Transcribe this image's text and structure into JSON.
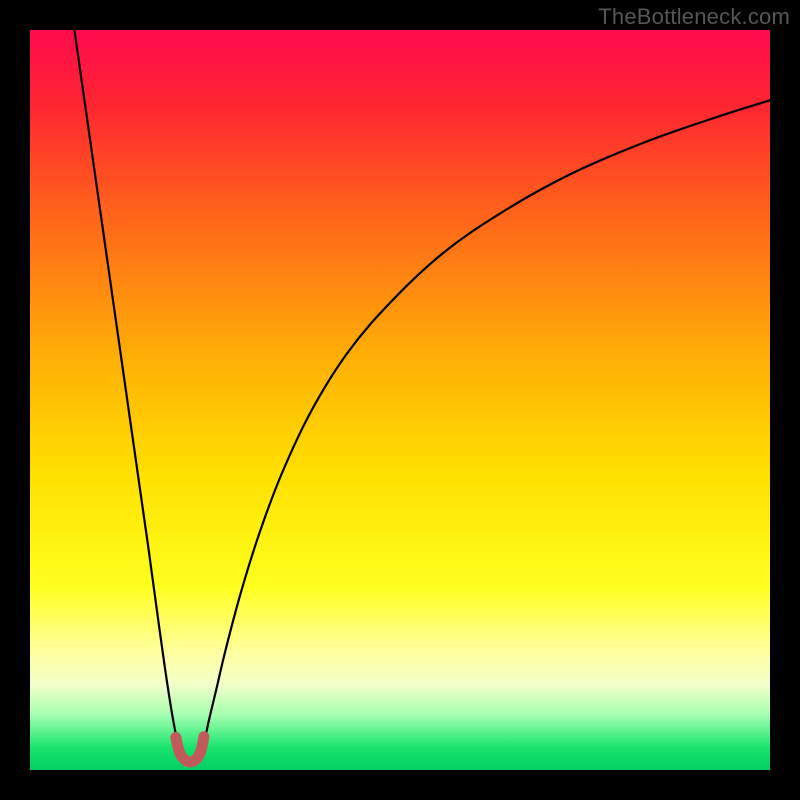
{
  "watermark": "TheBottleneck.com",
  "gradient": {
    "stops": [
      {
        "offset": 0.0,
        "color": "#ff0a4e"
      },
      {
        "offset": 0.1,
        "color": "#ff2531"
      },
      {
        "offset": 0.25,
        "color": "#ff641a"
      },
      {
        "offset": 0.45,
        "color": "#ffb205"
      },
      {
        "offset": 0.6,
        "color": "#ffe000"
      },
      {
        "offset": 0.75,
        "color": "#ffff1e"
      },
      {
        "offset": 0.84,
        "color": "#ffffa0"
      },
      {
        "offset": 0.885,
        "color": "#f2ffc8"
      },
      {
        "offset": 0.925,
        "color": "#a6ffb0"
      },
      {
        "offset": 0.97,
        "color": "#18e46c"
      },
      {
        "offset": 1.0,
        "color": "#00d062"
      }
    ]
  },
  "chart_data": {
    "type": "line",
    "title": "",
    "xlabel": "",
    "ylabel": "",
    "xlim": [
      0,
      100
    ],
    "ylim": [
      0,
      100
    ],
    "series": [
      {
        "name": "left-branch",
        "x": [
          6,
          8,
          10,
          12,
          14,
          16,
          17.5,
          18.5,
          19.3,
          20,
          20.5
        ],
        "y": [
          100,
          86,
          72,
          58,
          44,
          30,
          19,
          12,
          7,
          3.5,
          2.0
        ]
      },
      {
        "name": "right-branch",
        "x": [
          23,
          23.5,
          24.2,
          25.2,
          26.5,
          28.5,
          31,
          34,
          38,
          43,
          49,
          56,
          64,
          73,
          83,
          93,
          100
        ],
        "y": [
          2.0,
          3.6,
          6.8,
          11,
          16.5,
          24,
          32,
          40,
          48.5,
          56.5,
          63.5,
          70,
          75.5,
          80.5,
          84.8,
          88.3,
          90.5
        ]
      },
      {
        "name": "trough-marker",
        "x": [
          19.7,
          20.2,
          20.9,
          21.7,
          22.5,
          23.1,
          23.5
        ],
        "y": [
          4.4,
          2.4,
          1.4,
          1.1,
          1.5,
          2.6,
          4.5
        ]
      }
    ],
    "trough_x": 21.7,
    "trough_y": 1.1
  }
}
